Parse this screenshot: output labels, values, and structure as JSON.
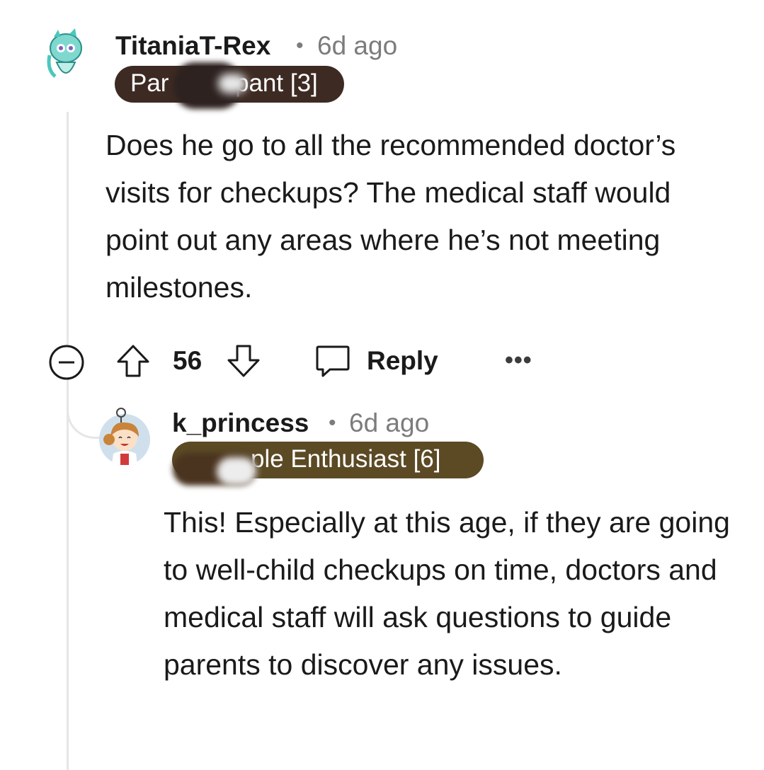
{
  "comment": {
    "username": "TitaniaT-Rex",
    "separator": "•",
    "time": "6d ago",
    "flair_left": "Par",
    "flair_right": "pant [3]",
    "flair_color": "#3d2b23",
    "body": "Does he go to all the recommended doctor’s visits for checkups? The medical staff would point out any areas where he’s not meeting milestones.",
    "avatar_icon": "dinosaur-avatar-icon"
  },
  "actions": {
    "collapse_icon": "collapse-minus-icon",
    "upvote_icon": "upvote-arrow-icon",
    "score": "56",
    "downvote_icon": "downvote-arrow-icon",
    "reply_icon": "speech-bubble-icon",
    "reply_label": "Reply",
    "more_label": "•••"
  },
  "reply": {
    "username": "k_princess",
    "separator": "•",
    "time": "6d ago",
    "flair_right": "ple Enthusiast [6]",
    "flair_color": "#5b4a24",
    "body": "This! Especially at this age, if they are going to well-child checkups on time, doctors and medical staff will ask questions to guide parents to discover any issues.",
    "avatar_icon": "girl-avatar-icon"
  }
}
